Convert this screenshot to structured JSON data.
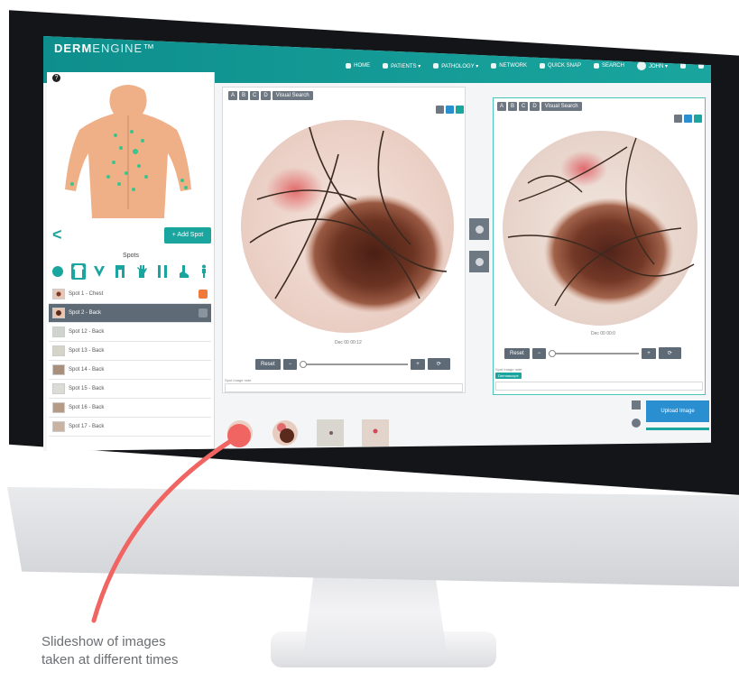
{
  "app": {
    "brand_main": "DERM",
    "brand_rest": "ENGINE™"
  },
  "nav": {
    "items": [
      {
        "label": "HOME",
        "icon": "home-icon"
      },
      {
        "label": "PATIENTS ▾",
        "icon": "patients-icon"
      },
      {
        "label": "PATHOLOGY ▾",
        "icon": "pathology-icon"
      },
      {
        "label": "NETWORK",
        "icon": "network-icon"
      },
      {
        "label": "QUICK SNAP",
        "icon": "camera-icon"
      },
      {
        "label": "SEARCH",
        "icon": "search-icon"
      },
      {
        "label": "JOHN ▾",
        "icon": "avatar-icon"
      }
    ]
  },
  "sidebar": {
    "help": "?",
    "back": "<",
    "add_spot": "+ Add Spot",
    "spots_title": "Spots",
    "spots": [
      {
        "label": "Spot 1 - Chest",
        "badge": "#f07a3a"
      },
      {
        "label": "Spot 2 - Back",
        "badge": "#8a949e"
      },
      {
        "label": "Spot 12 - Back"
      },
      {
        "label": "Spot 13 - Back"
      },
      {
        "label": "Spot 14 - Back"
      },
      {
        "label": "Spot 15 - Back"
      },
      {
        "label": "Spot 16 - Back"
      },
      {
        "label": "Spot 17 - Back"
      }
    ]
  },
  "viewer_left": {
    "abcd": [
      "A",
      "B",
      "C",
      "D"
    ],
    "visual_search": "Visual Search",
    "date": "Dec 00 00:12",
    "reset": "Reset",
    "note_label": "Spot Image note"
  },
  "viewer_right": {
    "abcd": [
      "A",
      "B",
      "C",
      "D"
    ],
    "visual_search": "Visual Search",
    "date": "Dec 00 00:0",
    "reset": "Reset",
    "note_label": "Spot Image note",
    "tag": "Dermascope"
  },
  "upload": {
    "label": "Upload Image"
  },
  "caption": {
    "line1": "Slideshow of images",
    "line2": "taken at different times"
  },
  "colors": {
    "accent": "#1aa59f",
    "annotation": "#f06462",
    "button": "#6e7883"
  }
}
